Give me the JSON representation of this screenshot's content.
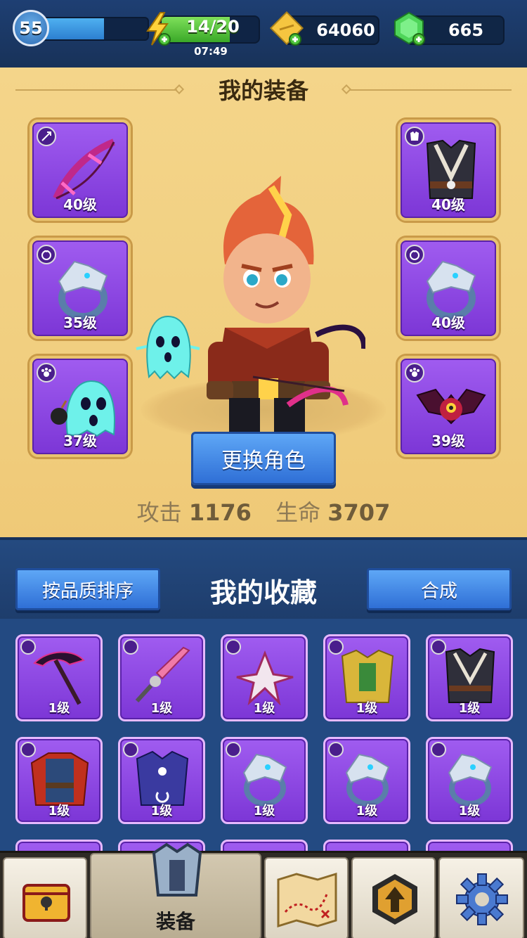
{
  "topbar": {
    "player_level": "55",
    "level_progress": 0.6,
    "energy": "14/20",
    "energy_progress": 0.7,
    "energy_timer": "07:49",
    "coins": "64060",
    "gems": "665",
    "icons": [
      "lightning-icon",
      "ticket-icon",
      "gem-icon"
    ]
  },
  "equipment": {
    "title": "我的装备",
    "slots": [
      {
        "name": "bow",
        "level": "40级",
        "type": "weapon-icon"
      },
      {
        "name": "ring",
        "level": "35级",
        "type": "ring-icon"
      },
      {
        "name": "ghost-pet",
        "level": "37级",
        "type": "paw-icon"
      },
      {
        "name": "armor",
        "level": "40级",
        "type": "armor-icon"
      },
      {
        "name": "ring",
        "level": "40级",
        "type": "ring-icon"
      },
      {
        "name": "bat-pet",
        "level": "39级",
        "type": "paw-icon"
      }
    ],
    "change_character": "更换角色",
    "attack_label": "攻击",
    "attack_value": "1176",
    "hp_label": "生命",
    "hp_value": "3707"
  },
  "collection": {
    "sort_button": "按品质排序",
    "title": "我的收藏",
    "merge_button": "合成",
    "items": [
      {
        "name": "scythe",
        "level": "1级",
        "type": "weapon-icon"
      },
      {
        "name": "sword",
        "level": "1级",
        "type": "weapon-icon"
      },
      {
        "name": "shuriken",
        "level": "1级",
        "type": "weapon-icon"
      },
      {
        "name": "gold-armor",
        "level": "1级",
        "type": "armor-icon"
      },
      {
        "name": "dark-armor",
        "level": "1级",
        "type": "armor-icon"
      },
      {
        "name": "red-robe",
        "level": "1级",
        "type": "armor-icon"
      },
      {
        "name": "blue-robe",
        "level": "1级",
        "type": "armor-icon"
      },
      {
        "name": "ring",
        "level": "1级",
        "type": "ring-icon"
      },
      {
        "name": "ring",
        "level": "1级",
        "type": "ring-icon"
      },
      {
        "name": "ring",
        "level": "1级",
        "type": "ring-icon"
      }
    ]
  },
  "nav": {
    "tabs": [
      {
        "name": "chest-tab",
        "label": ""
      },
      {
        "name": "equipment-tab",
        "label": "装备"
      },
      {
        "name": "map-tab",
        "label": ""
      },
      {
        "name": "upgrade-tab",
        "label": ""
      },
      {
        "name": "settings-tab",
        "label": ""
      }
    ]
  },
  "colors": {
    "rare_purple": "#8a45e0",
    "button_blue": "#3f86e6",
    "panel_gold": "#f2d283",
    "navy": "#1e3d6c"
  }
}
